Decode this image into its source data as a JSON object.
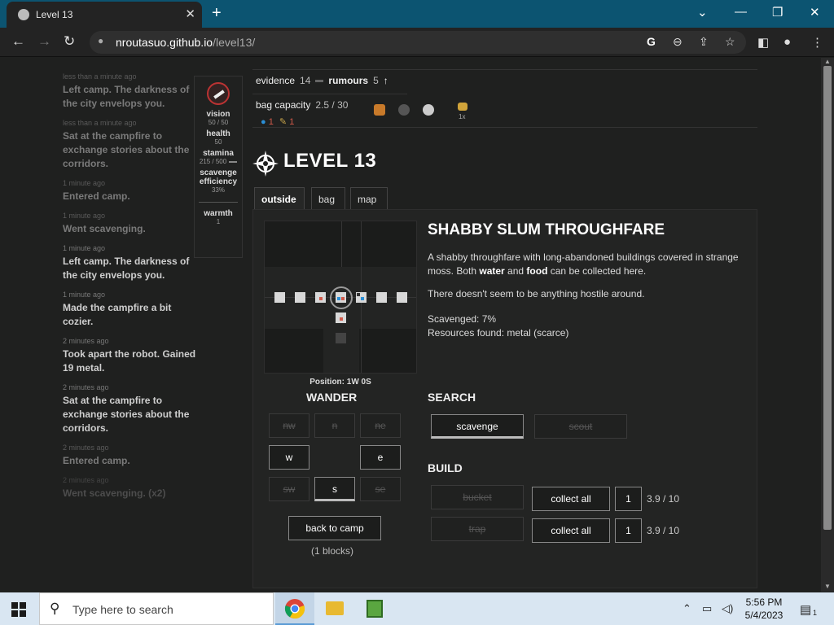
{
  "browser": {
    "tab_title": "Level 13",
    "tab_close": "✕",
    "new_tab": "+",
    "url_host": "nroutasuo.github.io",
    "url_path": "/level13/",
    "win_min": "—",
    "win_max": "❐",
    "win_close": "✕",
    "back": "←",
    "forward": "→",
    "reload": "↻",
    "lock": "🔒"
  },
  "log": [
    {
      "time": "less than a minute ago",
      "text": "Left camp. The darkness of the city envelops you.",
      "style": "faded"
    },
    {
      "time": "less than a minute ago",
      "text": "Sat at the campfire to exchange stories about the corridors.",
      "style": "faded"
    },
    {
      "time": "1 minute ago",
      "text": "Entered camp.",
      "style": "faded"
    },
    {
      "time": "1 minute ago",
      "text": "Went scavenging.",
      "style": "faded"
    },
    {
      "time": "1 minute ago",
      "text": "Left camp. The darkness of the city envelops you.",
      "style": "normal"
    },
    {
      "time": "1 minute ago",
      "text": "Made the campfire a bit cozier.",
      "style": "normal"
    },
    {
      "time": "2 minutes ago",
      "text": "Took apart the robot. Gained 19 metal.",
      "style": "normal"
    },
    {
      "time": "2 minutes ago",
      "text": "Sat at the campfire to exchange stories about the corridors.",
      "style": "normal"
    },
    {
      "time": "2 minutes ago",
      "text": "Entered camp.",
      "style": "faded"
    },
    {
      "time": "2 minutes ago",
      "text": "Went scavenging. (x2)",
      "style": "faded2"
    }
  ],
  "stats": {
    "vision_label": "vision",
    "vision_val": "50 / 50",
    "health_label": "health",
    "health_val": "50",
    "stamina_label": "stamina",
    "stamina_val": "215 / 500",
    "scav_label": "scavenge efficiency",
    "scav_val": "33%",
    "warmth_label": "warmth",
    "warmth_val": "1"
  },
  "header": {
    "evidence_label": "evidence",
    "evidence_val": "14",
    "rumours_label": "rumours",
    "rumours_val": "5",
    "bag_label": "bag capacity",
    "bag_val": "2.5 / 30",
    "res_water": "1",
    "res_food": "1",
    "lock_badge": "1x",
    "arrow": "↑"
  },
  "level": {
    "title": "LEVEL 13"
  },
  "tabs": [
    {
      "label": "outside"
    },
    {
      "label": "bag"
    },
    {
      "label": "map"
    }
  ],
  "location": {
    "position": "Position: 1W 0S",
    "title": "SHABBY SLUM THROUGHFARE",
    "desc_a": "A shabby throughfare with long-abandoned buildings covered in strange moss. Both ",
    "desc_water": "water",
    "desc_and": " and ",
    "desc_food": "food",
    "desc_b": " can be collected here.",
    "hostile": "There doesn't seem to be anything hostile around.",
    "scavenged": "Scavenged: 7%",
    "resources": "Resources found: metal (scarce)"
  },
  "wander": {
    "title": "WANDER",
    "nw": "nw",
    "n": "n",
    "ne": "ne",
    "w": "w",
    "e": "e",
    "sw": "sw",
    "s": "s",
    "se": "se",
    "back_to_camp": "back to camp",
    "blocks": "(1 blocks)"
  },
  "search": {
    "title": "SEARCH",
    "scavenge": "scavenge",
    "scout": "scout"
  },
  "build": {
    "title": "BUILD",
    "bucket": "bucket",
    "trap": "trap",
    "collect_all": "collect all",
    "qty1": "1",
    "qty2": "1",
    "cap1": "3.9 / 10",
    "cap2": "3.9 / 10"
  },
  "taskbar": {
    "search_placeholder": "Type here to search",
    "time": "5:56 PM",
    "date": "5/4/2023",
    "notif": "1"
  },
  "colors": {
    "water": "#2a8fd6",
    "food": "#d25a4a",
    "accent": "#0c5471"
  }
}
